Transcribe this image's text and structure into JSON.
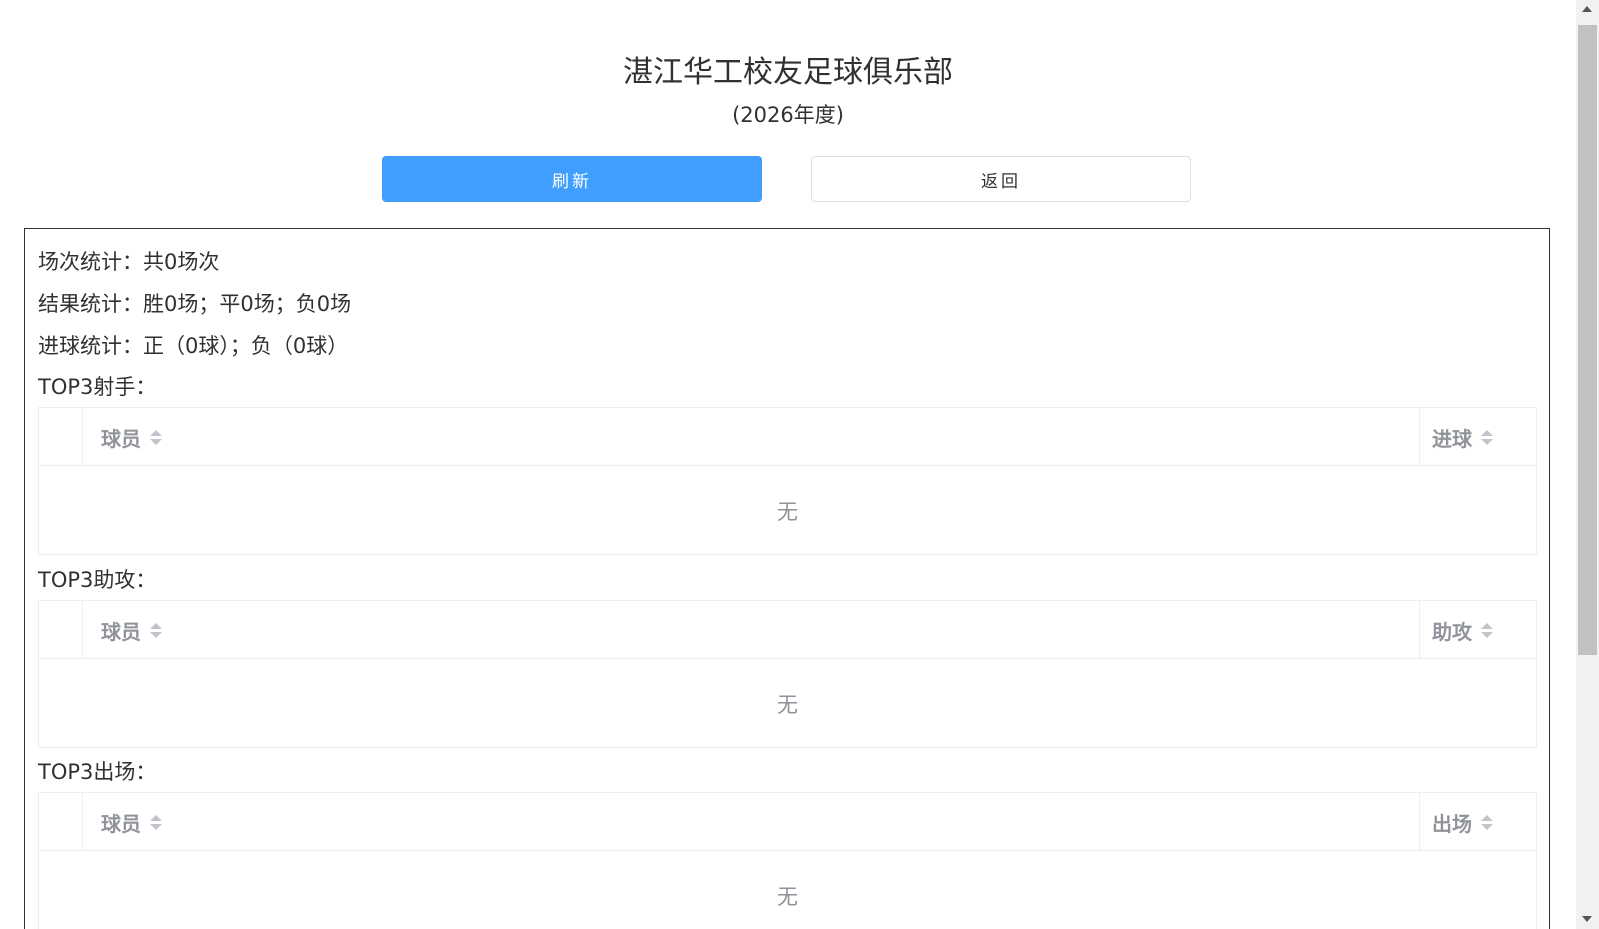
{
  "header": {
    "title": "湛江华工校友足球俱乐部",
    "subtitle": "(2026年度)"
  },
  "buttons": {
    "refresh_label": "刷新",
    "back_label": "返回"
  },
  "stats": {
    "matches": "场次统计：共0场次",
    "results": "结果统计：胜0场；平0场；负0场",
    "goals": "进球统计：正（0球）；负（0球）"
  },
  "top_scorers": {
    "label": "TOP3射手：",
    "col_player": "球员",
    "col_value": "进球",
    "empty": "无"
  },
  "top_assists": {
    "label": "TOP3助攻：",
    "col_player": "球员",
    "col_value": "助攻",
    "empty": "无"
  },
  "top_appearances": {
    "label": "TOP3出场：",
    "col_player": "球员",
    "col_value": "出场",
    "empty": "无"
  },
  "colors": {
    "primary": "#409eff",
    "header_text": "#909399",
    "border": "#ebeef5"
  }
}
